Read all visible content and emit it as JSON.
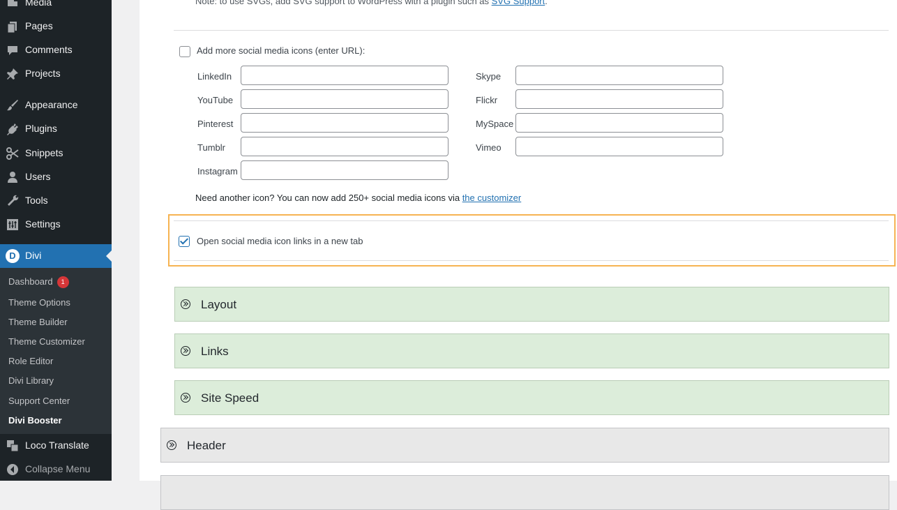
{
  "sidebar": {
    "items": [
      {
        "label": "Media",
        "icon": "media-icon"
      },
      {
        "label": "Pages",
        "icon": "pages-icon"
      },
      {
        "label": "Comments",
        "icon": "comments-icon"
      },
      {
        "label": "Projects",
        "icon": "pin-icon"
      },
      {
        "label": "Appearance",
        "icon": "brush-icon"
      },
      {
        "label": "Plugins",
        "icon": "plug-icon"
      },
      {
        "label": "Snippets",
        "icon": "scissors-icon"
      },
      {
        "label": "Users",
        "icon": "user-icon"
      },
      {
        "label": "Tools",
        "icon": "wrench-icon"
      },
      {
        "label": "Settings",
        "icon": "sliders-icon"
      }
    ],
    "divi": {
      "label": "Divi",
      "logo_letter": "D"
    },
    "submenu": [
      {
        "label": "Dashboard",
        "badge": "1"
      },
      {
        "label": "Theme Options"
      },
      {
        "label": "Theme Builder"
      },
      {
        "label": "Theme Customizer"
      },
      {
        "label": "Role Editor"
      },
      {
        "label": "Divi Library"
      },
      {
        "label": "Support Center"
      },
      {
        "label": "Divi Booster",
        "current": true
      }
    ],
    "bottom_items": [
      {
        "label": "Loco Translate",
        "icon": "translate-icon"
      },
      {
        "label": "Collapse Menu",
        "icon": "collapse-icon"
      }
    ]
  },
  "content": {
    "note_prefix": "Note: to use SVGs, add SVG support to WordPress with a plugin such as ",
    "note_link": "SVG Support",
    "note_suffix": ".",
    "add_more_label": "Add more social media icons (enter URL):",
    "fields_left": [
      "LinkedIn",
      "YouTube",
      "Pinterest",
      "Tumblr",
      "Instagram"
    ],
    "fields_right": [
      "Skype",
      "Flickr",
      "MySpace",
      "Vimeo"
    ],
    "need_icon_text": "Need another icon? You can now add 250+ social media icons via ",
    "need_icon_link": "the customizer",
    "open_new_tab_label": "Open social media icon links in a new tab",
    "sections": [
      "Layout",
      "Links",
      "Site Speed",
      "Header"
    ]
  },
  "colors": {
    "sidebar_bg": "#1d2327",
    "accent": "#2271b1",
    "highlight": "#f6b352",
    "section_green": "#dcedda",
    "badge": "#d63638"
  }
}
